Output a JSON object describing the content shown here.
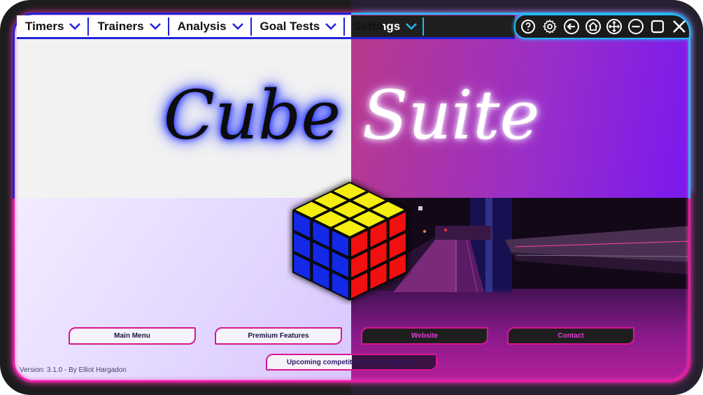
{
  "menu": {
    "items": [
      {
        "label": "Timers"
      },
      {
        "label": "Trainers"
      },
      {
        "label": "Analysis"
      },
      {
        "label": "Goal Tests"
      },
      {
        "label": "Settings"
      }
    ]
  },
  "window_controls": [
    {
      "icon": "help-icon"
    },
    {
      "icon": "gear-icon"
    },
    {
      "icon": "back-arrow-icon"
    },
    {
      "icon": "home-icon"
    },
    {
      "icon": "move-icon"
    },
    {
      "icon": "minimize-icon"
    },
    {
      "icon": "maximize-icon"
    },
    {
      "icon": "close-icon"
    }
  ],
  "title": {
    "word1": "Cube",
    "word2": "Suite"
  },
  "buttons": {
    "main_menu": "Main Menu",
    "premium": "Premium Features",
    "website": "Website",
    "contact": "Contact"
  },
  "competitions_label": "Upcoming competitions in your area: 4",
  "version_label": "Version: 3.1.0 - By Elliot Hargadon",
  "colors": {
    "accent_blue": "#1e22d8",
    "accent_cyan": "#24b8f5",
    "accent_pink": "#e81aa0",
    "cube_top": "#f5ee10",
    "cube_left": "#1428e8",
    "cube_right": "#f01010"
  }
}
